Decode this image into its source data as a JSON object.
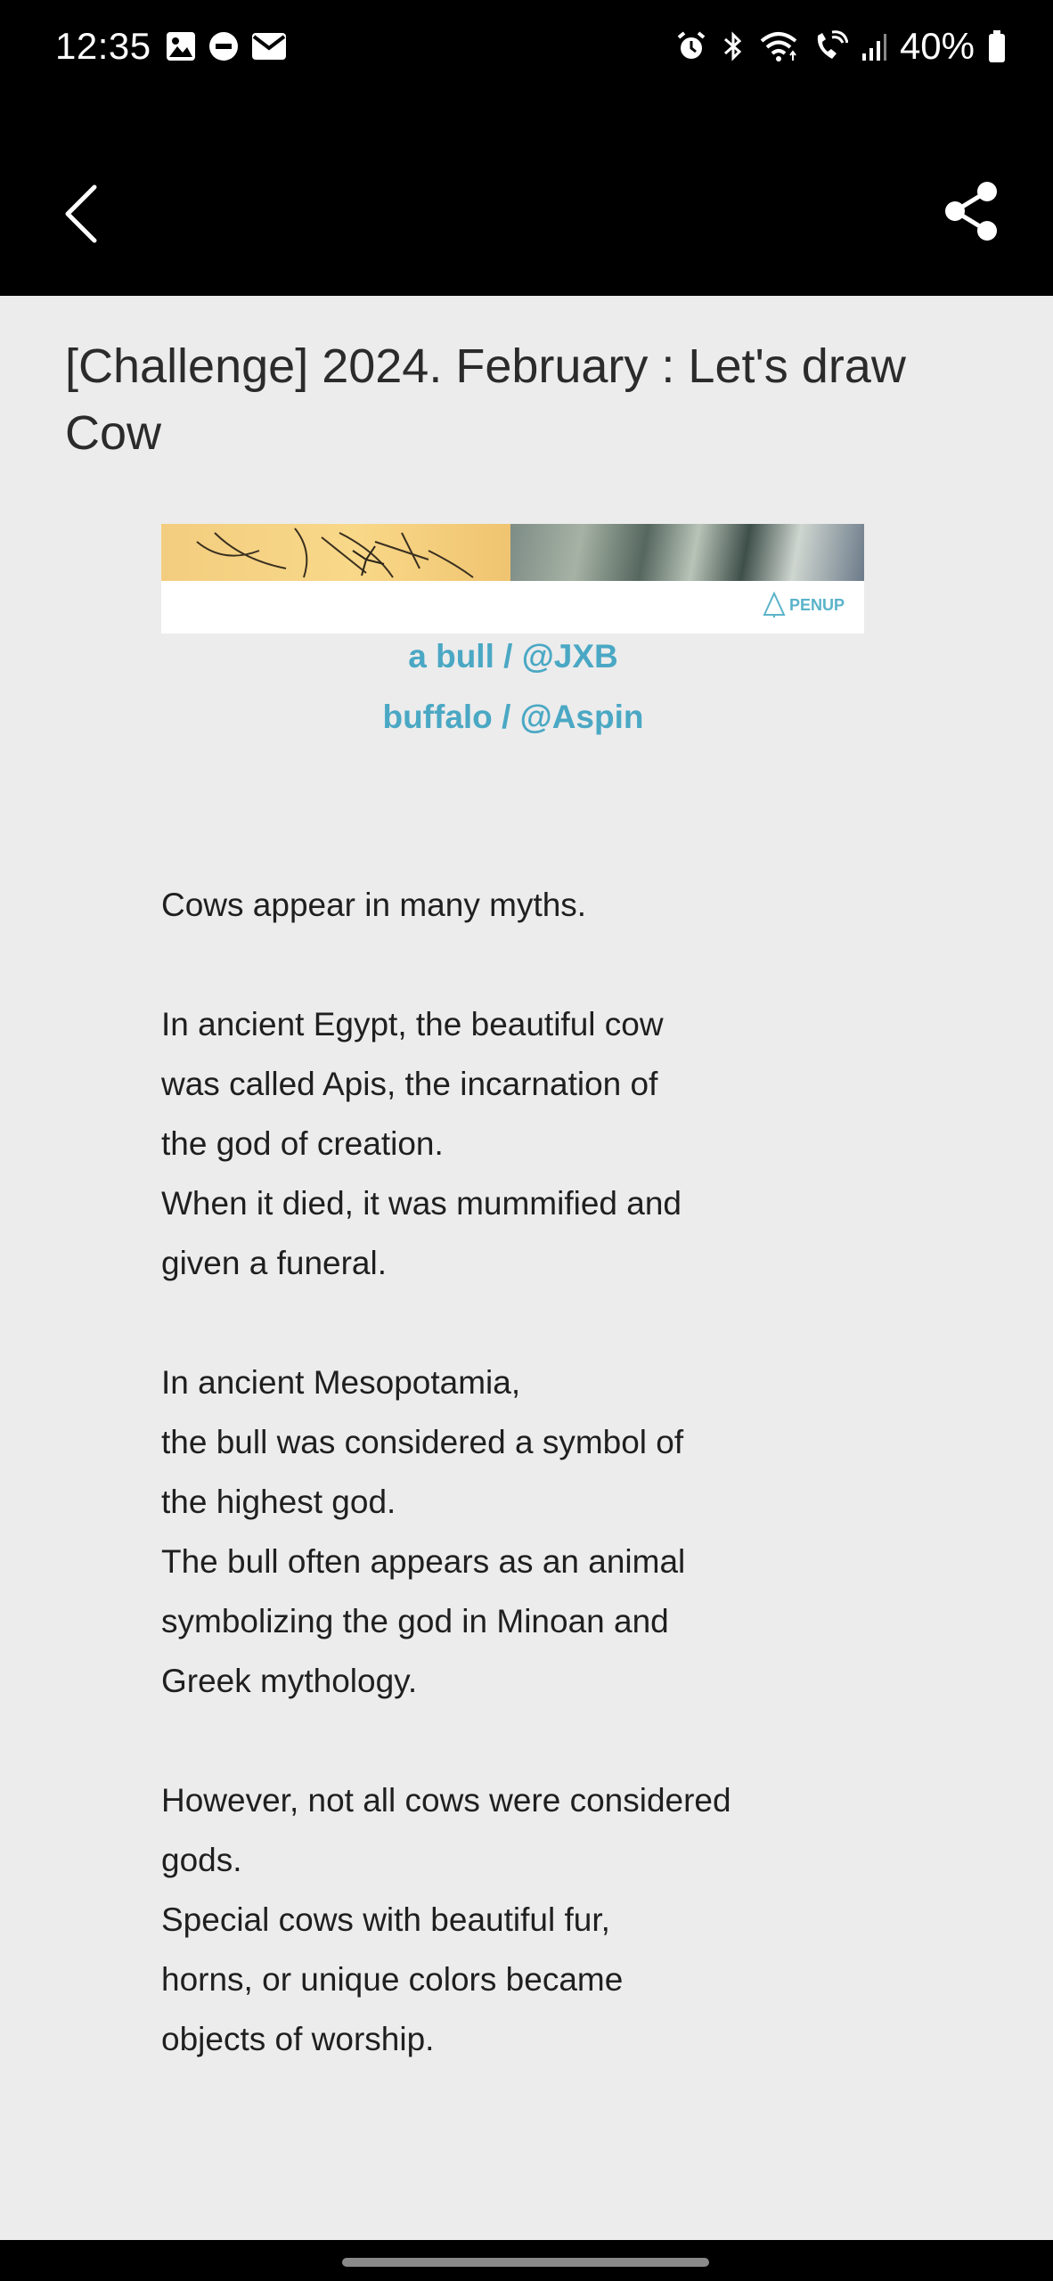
{
  "status_bar": {
    "time": "12:35",
    "battery": "40%",
    "icons_left": [
      "image-icon",
      "dnd-icon",
      "mail-icon"
    ],
    "icons_right": [
      "alarm-icon",
      "bluetooth-icon",
      "wifi-icon",
      "wifi-call-icon",
      "signal-icon",
      "battery-icon"
    ]
  },
  "app_bar": {
    "back_icon": "chevron-left-icon",
    "share_icon": "share-icon"
  },
  "article": {
    "title": "[Challenge] 2024. February : Let's draw Cow",
    "banner_logo_text": "PENUP",
    "captions": [
      "a bull / @JXB",
      "buffalo / @Aspin"
    ],
    "paragraphs": [
      [
        "Cows appear in many myths."
      ],
      [
        "In ancient Egypt, the beautiful cow",
        "was called Apis, the incarnation of",
        "the god of creation.",
        "When it died, it was mummified and",
        "given a funeral."
      ],
      [
        "In ancient Mesopotamia,",
        "the bull was considered a symbol of",
        "the highest god.",
        "The bull often appears as an animal",
        "symbolizing the god in Minoan and",
        "Greek mythology."
      ],
      [
        "However, not all cows were considered",
        "gods.",
        "Special cows with beautiful fur,",
        "horns, or unique colors became",
        "objects of worship."
      ]
    ]
  },
  "colors": {
    "link": "#4aa8c4",
    "background": "#ececec",
    "bars": "#000000"
  }
}
